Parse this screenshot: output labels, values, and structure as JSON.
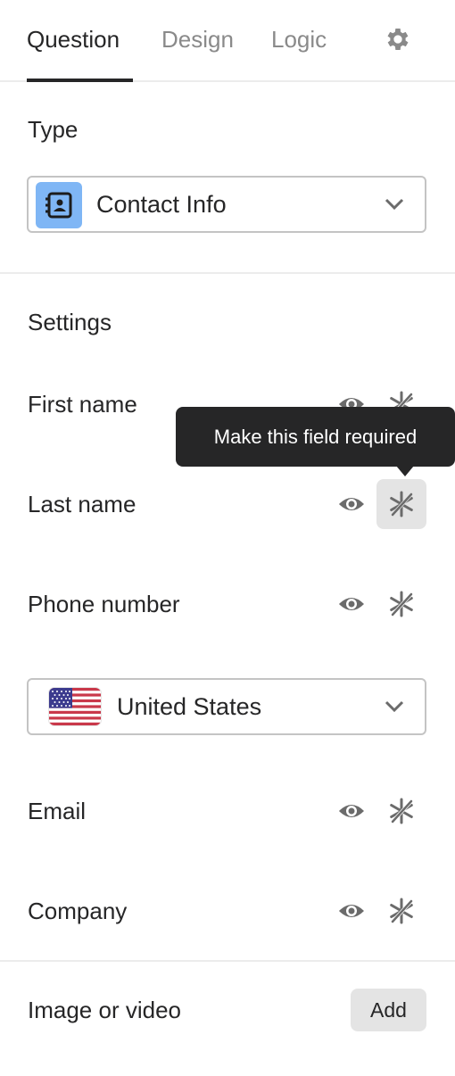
{
  "tabs": [
    {
      "label": "Question",
      "active": true
    },
    {
      "label": "Design",
      "active": false
    },
    {
      "label": "Logic",
      "active": false
    }
  ],
  "settings_icon": "gear-icon",
  "type_section": {
    "title": "Type",
    "selected": "Contact Info",
    "icon": "contact-book-icon",
    "icon_bg": "#7fb6f5"
  },
  "settings_section": {
    "title": "Settings",
    "fields": [
      {
        "label": "First name",
        "visible_icon": "eye-icon",
        "required_icon": "asterisk-off-icon"
      },
      {
        "label": "Last name",
        "visible_icon": "eye-icon",
        "required_icon": "asterisk-off-icon"
      },
      {
        "label": "Phone number",
        "visible_icon": "eye-icon",
        "required_icon": "asterisk-off-icon"
      },
      {
        "label": "Email",
        "visible_icon": "eye-icon",
        "required_icon": "asterisk-off-icon"
      },
      {
        "label": "Company",
        "visible_icon": "eye-icon",
        "required_icon": "asterisk-off-icon"
      }
    ],
    "country": {
      "selected": "United States",
      "icon": "us-flag-icon"
    },
    "tooltip": "Make this field required"
  },
  "media_section": {
    "title": "Image or video",
    "add_label": "Add"
  }
}
